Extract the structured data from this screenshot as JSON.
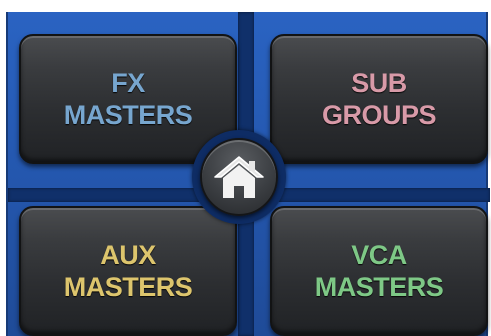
{
  "pads": {
    "fx": {
      "line1": "FX",
      "line2": "MASTERS",
      "color": "#77a6cf"
    },
    "sub": {
      "line1": "SUB",
      "line2": "GROUPS",
      "color": "#d89aa8"
    },
    "aux": {
      "line1": "AUX",
      "line2": "MASTERS",
      "color": "#ddc56d"
    },
    "vca": {
      "line1": "VCA",
      "line2": "MASTERS",
      "color": "#7ec886"
    }
  },
  "home": {
    "icon": "home-icon"
  },
  "colors": {
    "panel_blue": "#2457ae",
    "separator": "#10306a",
    "pad_dark": "#2c2e31"
  }
}
